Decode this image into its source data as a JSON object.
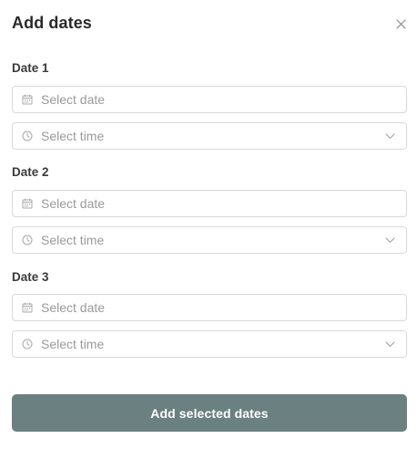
{
  "dialog": {
    "title": "Add dates",
    "close_icon": "close-icon"
  },
  "dates": [
    {
      "label": "Date 1",
      "date_placeholder": "Select date",
      "time_placeholder": "Select time"
    },
    {
      "label": "Date 2",
      "date_placeholder": "Select date",
      "time_placeholder": "Select time"
    },
    {
      "label": "Date 3",
      "date_placeholder": "Select date",
      "time_placeholder": "Select time"
    }
  ],
  "actions": {
    "submit_label": "Add selected dates"
  },
  "colors": {
    "primary_button": "#6b8080",
    "border": "#d9d9d9",
    "placeholder": "#9a9a9a"
  },
  "icons": {
    "date": "calendar-icon",
    "time": "clock-icon",
    "dropdown": "chevron-down-icon"
  }
}
